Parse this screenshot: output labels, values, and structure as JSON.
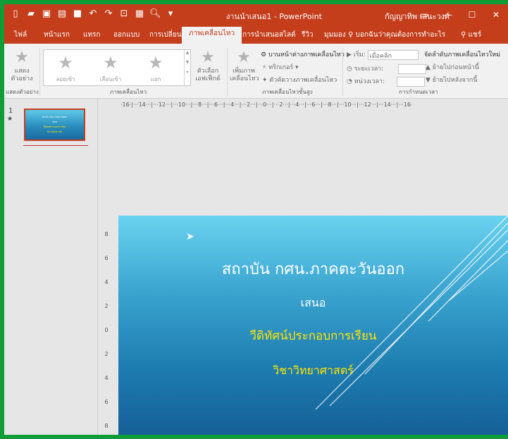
{
  "titlebar": {
    "title": "งานนำเสนอ1  -  PowerPoint",
    "user": "กัญญาทิพ เสนะวงศ์"
  },
  "tabs": [
    {
      "label": "ไฟล์"
    },
    {
      "label": "หน้าแรก"
    },
    {
      "label": "แทรก"
    },
    {
      "label": "ออกแบบ"
    },
    {
      "label": "การเปลี่ยน"
    },
    {
      "label": "ภาพเคลื่อนไหว"
    },
    {
      "label": "การนำเสนอสไลด์"
    },
    {
      "label": "รีวิว"
    },
    {
      "label": "มุมมอง"
    }
  ],
  "tell_me": "บอกฉันว่าคุณต้องการทำอะไร",
  "share": "แชร์",
  "ribbon": {
    "preview_label": "แสดง ตัวอย่าง",
    "preview_group": "แสดงตัวอย่าง",
    "gallery": [
      "ลอยเข้า",
      "เลือนเข้า",
      "แยก"
    ],
    "effect_options": "ตัวเลือกเอฟเฟ็กต์",
    "animations_group": "ภาพเคลื่อนไหว",
    "add_animation": "เพิ่มภาพเคลื่อนไหว",
    "animation_pane": "บานหน้าต่างภาพเคลื่อนไหว",
    "trigger": "ทริกเกอร์",
    "animation_painter": "ตัวคัดวางภาพเคลื่อนไหว",
    "advanced_group": "ภาพเคลื่อนไหวขั้นสูง",
    "start_label": "เริ่ม:",
    "start_value": "เมื่อคลิก",
    "duration_label": "ระยะเวลา:",
    "delay_label": "หน่วงเวลา:",
    "reorder_label": "จัดลำดับภาพเคลื่อนไหวใหม่",
    "move_earlier": "ย้ายไปก่อนหน้านี้",
    "move_later": "ย้ายไปหลังจากนี้",
    "timing_group": "การกำหนดเวลา"
  },
  "thumbnail": {
    "number": "1",
    "anim_mark": "★"
  },
  "ruler": {
    "horizontal": "·16·|···14···|···12···|···10···|···8···|···6···|···4···|···2···|···0···|···2···|···4···|···6···|···8···|···10···|···12···|···14···|···16·",
    "vertical": [
      "8",
      "6",
      "4",
      "2",
      "0",
      "2",
      "4",
      "6",
      "8"
    ]
  },
  "slide": {
    "title": "สถาบัน กศน.ภาคตะวันออก",
    "line1": "เสนอ",
    "line2": "วีดิทัศน์ประกอบการเรียน",
    "line3": "วิชาวิทยาศาสตร์"
  }
}
